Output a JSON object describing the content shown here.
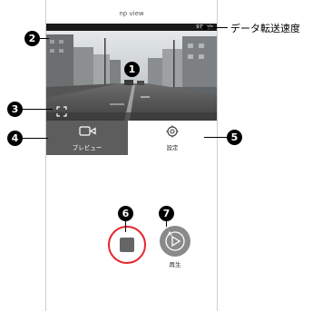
{
  "app": {
    "title": "np view"
  },
  "video": {
    "speed_text": "97Kb/s"
  },
  "tabs": [
    {
      "label": "プレビュー",
      "icon": "video-camera-icon",
      "active": true
    },
    {
      "label": "設定",
      "icon": "gear-icon",
      "active": false
    }
  ],
  "controls": {
    "record_icon": "stop-icon",
    "playback_icon": "play-icon",
    "playback_label": "再生"
  },
  "annotations": {
    "callouts": [
      "1",
      "2",
      "3",
      "4",
      "5",
      "6",
      "7"
    ],
    "speed_label": "データ転送速度"
  },
  "colors": {
    "active_tab": "#5d5d5d",
    "record_ring": "#e5252b",
    "playback_button": "#8a8a8a",
    "speed_strip": "#1a1a1a"
  }
}
